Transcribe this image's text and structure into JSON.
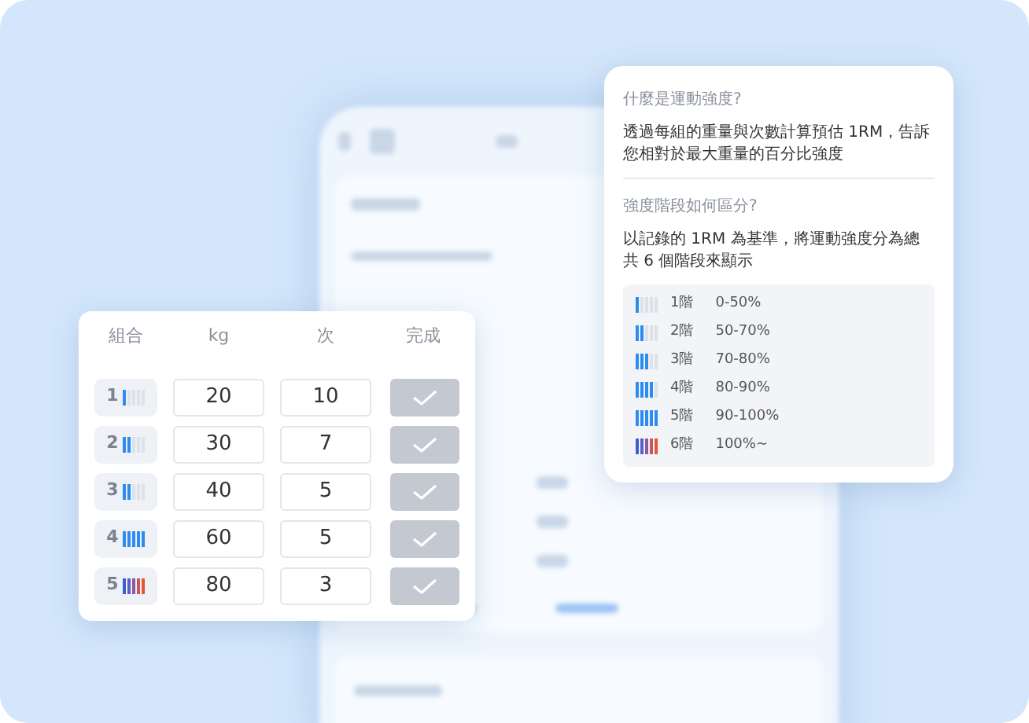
{
  "sets_card": {
    "columns": [
      "組合",
      "kg",
      "次",
      "完成"
    ],
    "rows": [
      {
        "set": "1",
        "level": 0.2,
        "kind": "normal",
        "kg": "20",
        "reps": "10",
        "checked": false
      },
      {
        "set": "2",
        "level": 0.4,
        "kind": "normal",
        "kg": "30",
        "reps": "7",
        "checked": false
      },
      {
        "set": "3",
        "level": 0.4,
        "kind": "normal",
        "kg": "40",
        "reps": "5",
        "checked": false
      },
      {
        "set": "4",
        "level": 1,
        "kind": "normal",
        "kg": "60",
        "reps": "5",
        "checked": false
      },
      {
        "set": "5",
        "level": 1,
        "kind": "max",
        "kg": "80",
        "reps": "3",
        "checked": false
      }
    ]
  },
  "info_card": {
    "sections": [
      {
        "question": "什麼是運動強度?",
        "answer": "透過每組的重量與次數計算預估 1RM，告訴您相對於最大重量的百分比強度"
      },
      {
        "question": "強度階段如何區分?",
        "answer": "以記錄的 1RM 為基準，將運動強度分為總共 6 個階段來顯示"
      }
    ],
    "stages": [
      {
        "name": "1階",
        "range": "0-50%",
        "level": 0.2,
        "kind": "normal"
      },
      {
        "name": "2階",
        "range": "50-70%",
        "level": 0.4,
        "kind": "normal"
      },
      {
        "name": "3階",
        "range": "70-80%",
        "level": 0.6,
        "kind": "normal"
      },
      {
        "name": "4階",
        "range": "80-90%",
        "level": 0.8,
        "kind": "normal"
      },
      {
        "name": "5階",
        "range": "90-100%",
        "level": 1,
        "kind": "normal"
      },
      {
        "name": "6階",
        "range": "100%~",
        "level": 1,
        "kind": "max"
      }
    ]
  }
}
